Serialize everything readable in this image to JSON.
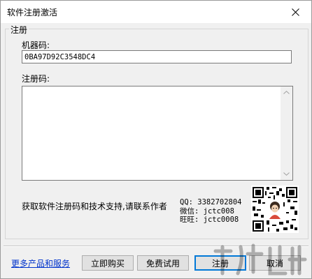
{
  "window": {
    "title": "软件注册激活"
  },
  "group": {
    "legend": "注册",
    "machine_code_label": "机器码:",
    "machine_code_value": "0BA97D92C3548DC4",
    "reg_code_label": "注册码:",
    "reg_code_value": ""
  },
  "contact": {
    "text": "获取软件注册码和技术支持,请联系作者",
    "qq": "QQ: 3382702804",
    "wechat": "微信: jctc008",
    "wangwang": "旺旺: jctc0008"
  },
  "footer": {
    "more_link": "更多产品和服务",
    "buy_button": "立即购买",
    "trial_button": "免费试用",
    "register_button": "注册",
    "cancel_button": "取消"
  },
  "colors": {
    "link": "#0033cc",
    "focus_border": "#0078d7",
    "window_bg": "#f0f0f0"
  },
  "icons": [
    "close-icon",
    "scroll-up-icon",
    "scroll-down-icon",
    "qr-code-icon"
  ]
}
